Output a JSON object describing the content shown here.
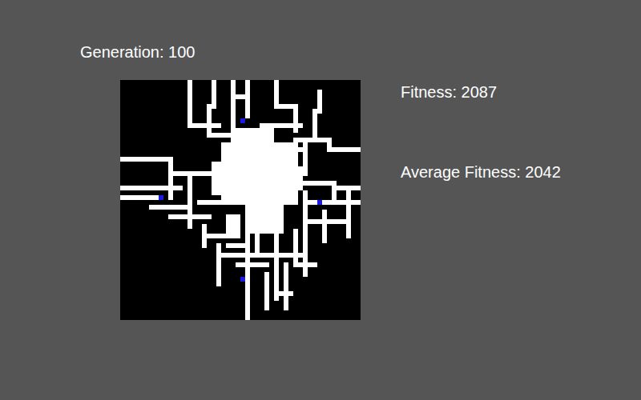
{
  "header": {
    "generation": "Generation: 100"
  },
  "stats": {
    "fitness": "Fitness: 2087",
    "average_fitness": "Average Fitness: 2042"
  },
  "board": {
    "size": 50,
    "blocks": [
      [
        21,
        13,
        16,
        13
      ],
      [
        24,
        10,
        8,
        4
      ],
      [
        19,
        17,
        4,
        7
      ],
      [
        26,
        26,
        8,
        6
      ],
      [
        22,
        28,
        3,
        4
      ],
      [
        34,
        18,
        4,
        5
      ]
    ],
    "paths": [
      [
        14,
        0,
        14,
        9
      ],
      [
        14,
        9,
        20,
        9
      ],
      [
        19,
        0,
        19,
        5
      ],
      [
        18,
        5,
        18,
        11
      ],
      [
        18,
        11,
        24,
        11
      ],
      [
        23,
        0,
        23,
        12
      ],
      [
        26,
        0,
        26,
        7
      ],
      [
        24,
        3,
        26,
        3
      ],
      [
        32,
        0,
        32,
        5
      ],
      [
        32,
        5,
        36,
        5
      ],
      [
        36,
        5,
        36,
        10
      ],
      [
        29,
        9,
        37,
        9
      ],
      [
        41,
        2,
        41,
        6
      ],
      [
        40,
        6,
        40,
        12
      ],
      [
        38,
        12,
        38,
        19
      ],
      [
        36,
        12,
        43,
        12
      ],
      [
        43,
        12,
        43,
        14
      ],
      [
        43,
        14,
        50,
        14
      ],
      [
        33,
        14,
        38,
        14
      ],
      [
        0,
        16,
        10,
        16
      ],
      [
        10,
        16,
        10,
        24
      ],
      [
        10,
        19,
        21,
        19
      ],
      [
        0,
        22,
        12,
        22
      ],
      [
        0,
        24,
        8,
        24
      ],
      [
        6,
        26,
        14,
        26
      ],
      [
        10,
        28,
        18,
        28
      ],
      [
        14,
        20,
        14,
        30
      ],
      [
        16,
        25,
        21,
        25
      ],
      [
        38,
        21,
        44,
        21
      ],
      [
        44,
        21,
        44,
        24
      ],
      [
        44,
        22,
        50,
        22
      ],
      [
        38,
        25,
        50,
        25
      ],
      [
        47,
        22,
        47,
        32
      ],
      [
        42,
        27,
        42,
        33
      ],
      [
        38,
        29,
        46,
        29
      ],
      [
        38,
        23,
        38,
        40
      ],
      [
        36,
        31,
        36,
        38
      ],
      [
        17,
        30,
        17,
        34
      ],
      [
        17,
        32,
        24,
        32
      ],
      [
        20,
        34,
        20,
        42
      ],
      [
        20,
        36,
        38,
        36
      ],
      [
        26,
        32,
        26,
        50
      ],
      [
        24,
        38,
        30,
        38
      ],
      [
        32,
        32,
        32,
        45
      ],
      [
        30,
        40,
        30,
        47
      ],
      [
        34,
        38,
        34,
        47
      ],
      [
        33,
        44,
        35,
        44
      ],
      [
        36,
        38,
        40,
        38
      ],
      [
        28,
        29,
        28,
        36
      ],
      [
        22,
        34,
        26,
        34
      ]
    ],
    "agents": [
      {
        "x": 25,
        "y": 8
      },
      {
        "x": 8,
        "y": 24
      },
      {
        "x": 41,
        "y": 25
      },
      {
        "x": 25,
        "y": 41
      }
    ]
  }
}
